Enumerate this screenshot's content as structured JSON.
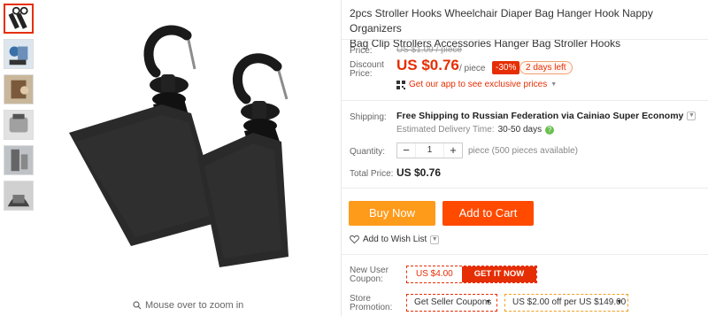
{
  "product": {
    "title_line1": "2pcs Stroller Hooks Wheelchair Diaper Bag Hanger Hook Nappy Organizers",
    "title_line2": "Bag Clip Strollers Accessories Hanger Bag Stroller Hooks"
  },
  "gallery": {
    "zoom_hint": "Mouse over to zoom in",
    "thumbnail_count": 6
  },
  "price": {
    "price_label": "Price:",
    "original": "US $1.09 / piece",
    "discount_label_1": "Discount",
    "discount_label_2": "Price:",
    "discounted": "US $0.76",
    "unit": "/ piece",
    "percent_off": "-30%",
    "days_left": "2 days left",
    "app_promo": "Get our app to see exclusive prices",
    "accent_color": "#e62e04"
  },
  "shipping": {
    "label": "Shipping:",
    "method": "Free Shipping to Russian Federation via Cainiao Super Economy",
    "estimated_label": "Estimated Delivery Time:",
    "estimated_value": "30-50 days"
  },
  "quantity": {
    "label": "Quantity:",
    "value": "1",
    "minus": "−",
    "plus": "+",
    "available": "piece (500 pieces available)"
  },
  "total": {
    "label": "Total Price:",
    "value": "US $0.76"
  },
  "actions": {
    "buy_now": "Buy Now",
    "add_to_cart": "Add to Cart",
    "add_to_wishlist": "Add to Wish List",
    "buy_color": "#ff9b1b",
    "cart_color": "#ff4a00"
  },
  "coupons": {
    "new_user_label_1": "New User",
    "new_user_label_2": "Coupon:",
    "new_user_amount": "US $4.00",
    "get_it_now": "GET IT NOW",
    "store_label_1": "Store",
    "store_label_2": "Promotion:",
    "seller_coupons": "Get Seller Coupons",
    "store_offer": "US $2.00 off per US $149.00"
  }
}
